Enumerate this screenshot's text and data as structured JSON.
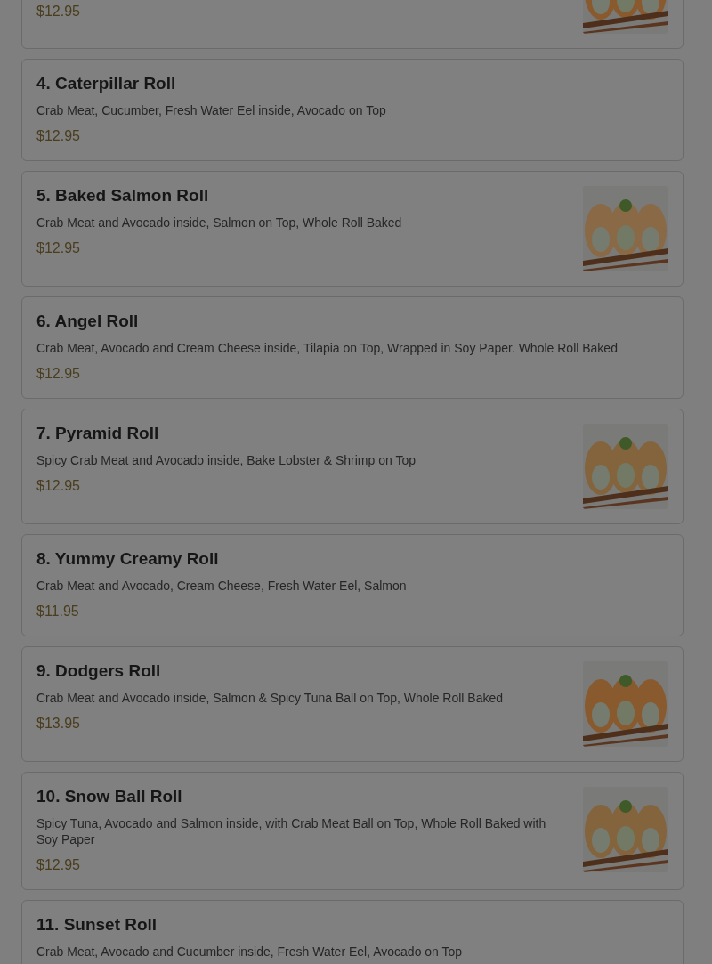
{
  "menu_items": [
    {
      "kind": "partial",
      "price": "$12.95"
    },
    {
      "kind": "item",
      "title": "4. Caterpillar Roll",
      "description": "Crab Meat, Cucumber, Fresh Water Eel inside, Avocado on Top",
      "price": "$12.95"
    },
    {
      "kind": "item",
      "title": "5. Baked Salmon Roll",
      "description": "Crab Meat and Avocado inside, Salmon on Top, Whole Roll Baked",
      "price": "$12.95"
    },
    {
      "kind": "item",
      "title": "6. Angel Roll",
      "description": "Crab Meat, Avocado and Cream Cheese inside, Tilapia on Top, Wrapped in Soy Paper. Whole Roll Baked",
      "price": "$12.95"
    },
    {
      "kind": "item",
      "title": "7. Pyramid Roll",
      "description": "Spicy Crab Meat and Avocado inside, Bake Lobster & Shrimp on Top",
      "price": "$12.95"
    },
    {
      "kind": "item",
      "title": "8. Yummy Creamy Roll",
      "description": "Crab Meat and Avocado, Cream Cheese, Fresh Water Eel, Salmon",
      "price": "$11.95"
    },
    {
      "kind": "item",
      "title": "9. Dodgers Roll",
      "description": "Crab Meat and Avocado inside, Salmon & Spicy Tuna Ball on Top, Whole Roll Baked",
      "price": "$13.95"
    },
    {
      "kind": "item",
      "title": "10. Snow Ball Roll",
      "description": "Spicy Tuna, Avocado and Salmon inside, with Crab Meat Ball on Top, Whole Roll Baked with Soy Paper",
      "price": "$12.95"
    },
    {
      "kind": "item",
      "title": "11. Sunset Roll",
      "description": "Crab Meat, Avocado and Cucumber inside, Fresh Water Eel, Avocado on Top"
    }
  ]
}
